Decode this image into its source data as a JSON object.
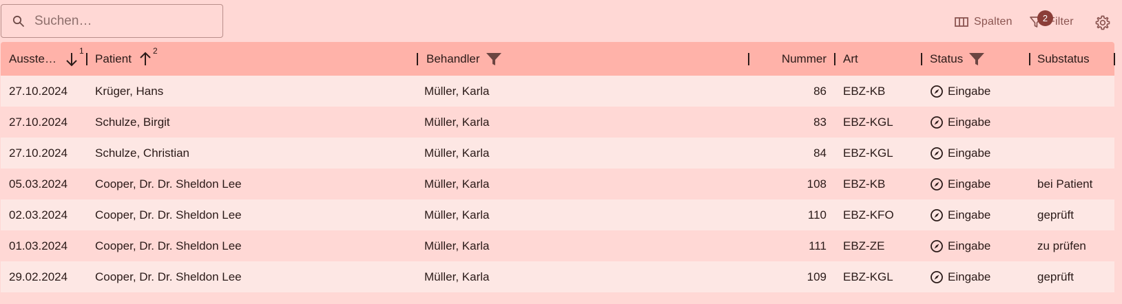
{
  "search": {
    "placeholder": "Suchen…"
  },
  "toolbar": {
    "columns_label": "Spalten",
    "filter_label": "Filter",
    "filter_count": "2"
  },
  "columns": {
    "ausgestellt": {
      "label": "Ausste…",
      "sort": "descending",
      "sort_order": "1"
    },
    "patient": {
      "label": "Patient",
      "sort": "ascending",
      "sort_order": "2"
    },
    "behandler": {
      "label": "Behandler",
      "filtered": true
    },
    "nummer": {
      "label": "Nummer"
    },
    "art": {
      "label": "Art"
    },
    "status": {
      "label": "Status",
      "filtered": true
    },
    "substatus": {
      "label": "Substatus"
    }
  },
  "rows": [
    {
      "date": "27.10.2024",
      "patient": "Krüger, Hans",
      "behandler": "Müller, Karla",
      "nummer": "86",
      "art": "EBZ-KB",
      "status": "Eingabe",
      "substatus": ""
    },
    {
      "date": "27.10.2024",
      "patient": "Schulze, Birgit",
      "behandler": "Müller, Karla",
      "nummer": "83",
      "art": "EBZ-KGL",
      "status": "Eingabe",
      "substatus": ""
    },
    {
      "date": "27.10.2024",
      "patient": "Schulze, Christian",
      "behandler": "Müller, Karla",
      "nummer": "84",
      "art": "EBZ-KGL",
      "status": "Eingabe",
      "substatus": ""
    },
    {
      "date": "05.03.2024",
      "patient": "Cooper, Dr. Dr. Sheldon Lee",
      "behandler": "Müller, Karla",
      "nummer": "108",
      "art": "EBZ-KB",
      "status": "Eingabe",
      "substatus": "bei Patient"
    },
    {
      "date": "02.03.2024",
      "patient": "Cooper, Dr. Dr. Sheldon Lee",
      "behandler": "Müller, Karla",
      "nummer": "110",
      "art": "EBZ-KFO",
      "status": "Eingabe",
      "substatus": "geprüft"
    },
    {
      "date": "01.03.2024",
      "patient": "Cooper, Dr. Dr. Sheldon Lee",
      "behandler": "Müller, Karla",
      "nummer": "111",
      "art": "EBZ-ZE",
      "status": "Eingabe",
      "substatus": "zu prüfen"
    },
    {
      "date": "29.02.2024",
      "patient": "Cooper, Dr. Dr. Sheldon Lee",
      "behandler": "Müller, Karla",
      "nummer": "109",
      "art": "EBZ-KGL",
      "status": "Eingabe",
      "substatus": "geprüft"
    }
  ],
  "icons": {
    "search": "search-icon",
    "columns": "view-column-icon",
    "filter": "filter-icon",
    "settings": "gear-icon",
    "sort_desc": "arrow-down-icon",
    "sort_asc": "arrow-up-icon",
    "column_filter": "filter-icon",
    "status": "compass-icon"
  },
  "colors": {
    "background": "#ffd8d5",
    "header": "#ffb2a9",
    "row_alt": "#fde7e4",
    "badge": "#8b3e38",
    "toolbar_text": "#8a5450"
  }
}
